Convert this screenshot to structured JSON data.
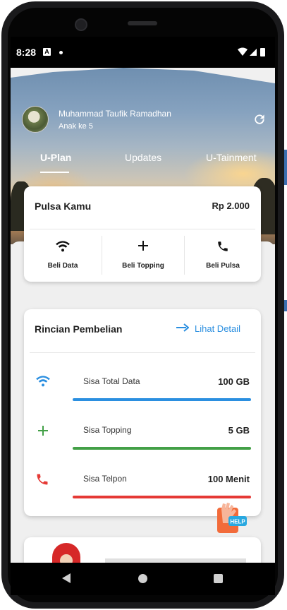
{
  "status_bar": {
    "time": "8:28",
    "notif_glyph": "A"
  },
  "profile": {
    "name": "Muhammad Taufik Ramadhan",
    "subtitle": "Anak ke 5"
  },
  "tabs": [
    {
      "label": "U-Plan",
      "active": true
    },
    {
      "label": "Updates",
      "active": false
    },
    {
      "label": "U-Tainment",
      "active": false
    }
  ],
  "pulsa_card": {
    "title": "Pulsa Kamu",
    "amount": "Rp 2.000",
    "actions": [
      {
        "label": "Beli Data",
        "icon": "wifi-icon"
      },
      {
        "label": "Beli Topping",
        "icon": "plus-icon"
      },
      {
        "label": "Beli Pulsa",
        "icon": "phone-icon"
      }
    ]
  },
  "rincian_card": {
    "title": "Rincian Pembelian",
    "link": "Lihat Detail",
    "rows": [
      {
        "label": "Sisa Total Data",
        "value": "100 GB",
        "icon": "wifi-icon",
        "color": "#2b8fe0"
      },
      {
        "label": "Sisa Topping",
        "value": "5 GB",
        "icon": "plus-icon",
        "color": "#43a047"
      },
      {
        "label": "Sisa Telpon",
        "value": "100 Menit",
        "icon": "phone-icon",
        "color": "#e53935"
      }
    ]
  },
  "help": {
    "label": "HELP"
  },
  "colors": {
    "accent": "#2b8fe0",
    "green": "#43a047",
    "red": "#e53935"
  }
}
